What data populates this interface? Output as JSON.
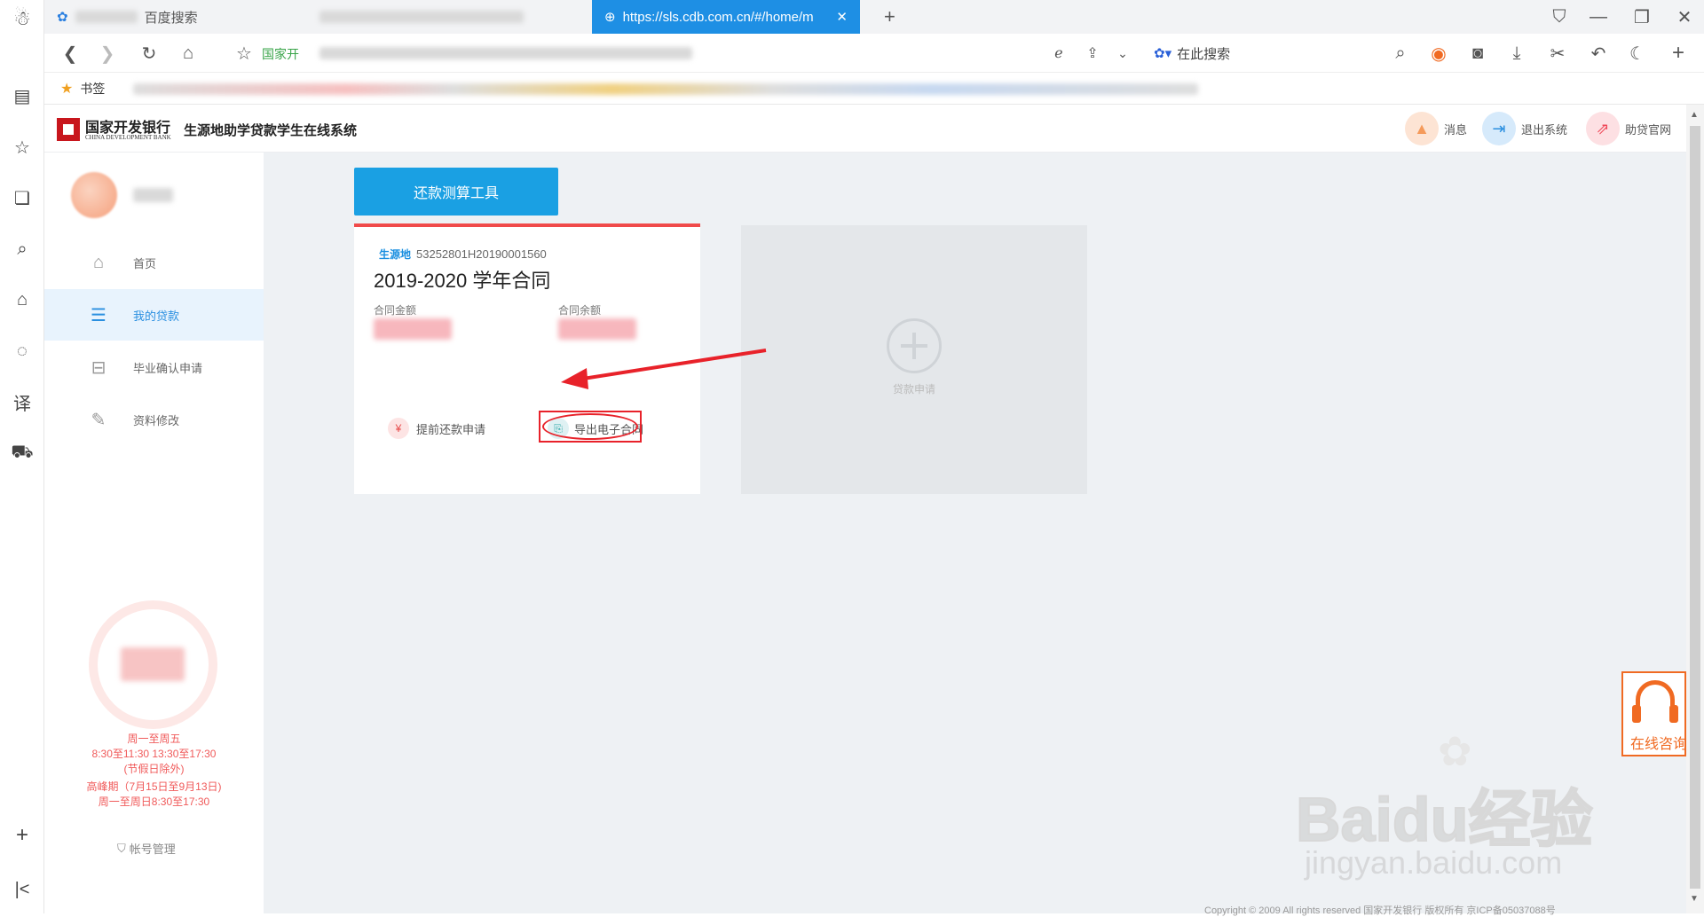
{
  "browser": {
    "tabs": [
      {
        "label": "百度搜索"
      },
      {
        "label": "https://sls.cdb.com.cn/#/home/m"
      }
    ],
    "new_tab_symbol": "+",
    "address_prefix": "国家开",
    "search_box_label": "在此搜索",
    "bookmarks_label": "书签"
  },
  "app": {
    "brand_cn": "国家开发银行",
    "brand_en": "CHINA DEVELOPMENT BANK",
    "system_name": "生源地助学贷款学生在线系统",
    "header_actions": [
      {
        "label": "消息",
        "icon": "bell-icon",
        "color": "#f59a5a"
      },
      {
        "label": "退出系统",
        "icon": "logout-icon",
        "color": "#2a8fe0"
      },
      {
        "label": "助贷官网",
        "icon": "external-link-icon",
        "color": "#f04a5a"
      }
    ]
  },
  "sidebar": {
    "items": [
      {
        "label": "首页",
        "icon": "home-icon",
        "active": false
      },
      {
        "label": "我的贷款",
        "icon": "list-icon",
        "active": true
      },
      {
        "label": "毕业确认申请",
        "icon": "inbox-icon",
        "active": false
      },
      {
        "label": "资料修改",
        "icon": "edit-icon",
        "active": false
      }
    ],
    "hours": [
      "周一至周五",
      "8:30至11:30 13:30至17:30",
      "(节假日除外)",
      "高峰期（7月15日至9月13日)",
      "周一至周日8:30至17:30"
    ],
    "account_label": "帐号管理"
  },
  "main": {
    "calc_button": "还款测算工具",
    "contract": {
      "tag": "生源地",
      "number": "53252801H20190001560",
      "title": "2019-2020 学年合同",
      "amount_label": "合同金额",
      "balance_label": "合同余额",
      "prepay_label": "提前还款申请",
      "export_label": "导出电子合同"
    },
    "apply_label": "贷款申请"
  },
  "widgets": {
    "online_consult": "在线咨询",
    "watermark_brand": "Baidu经验",
    "watermark_url": "jingyan.baidu.com",
    "footer": "Copyright © 2009 All rights reserved 国家开发银行 版权所有 京ICP备05037088号"
  },
  "colors": {
    "accent": "#1aa0e3",
    "card_top": "#f04a4a",
    "annotation": "#e8222a"
  }
}
